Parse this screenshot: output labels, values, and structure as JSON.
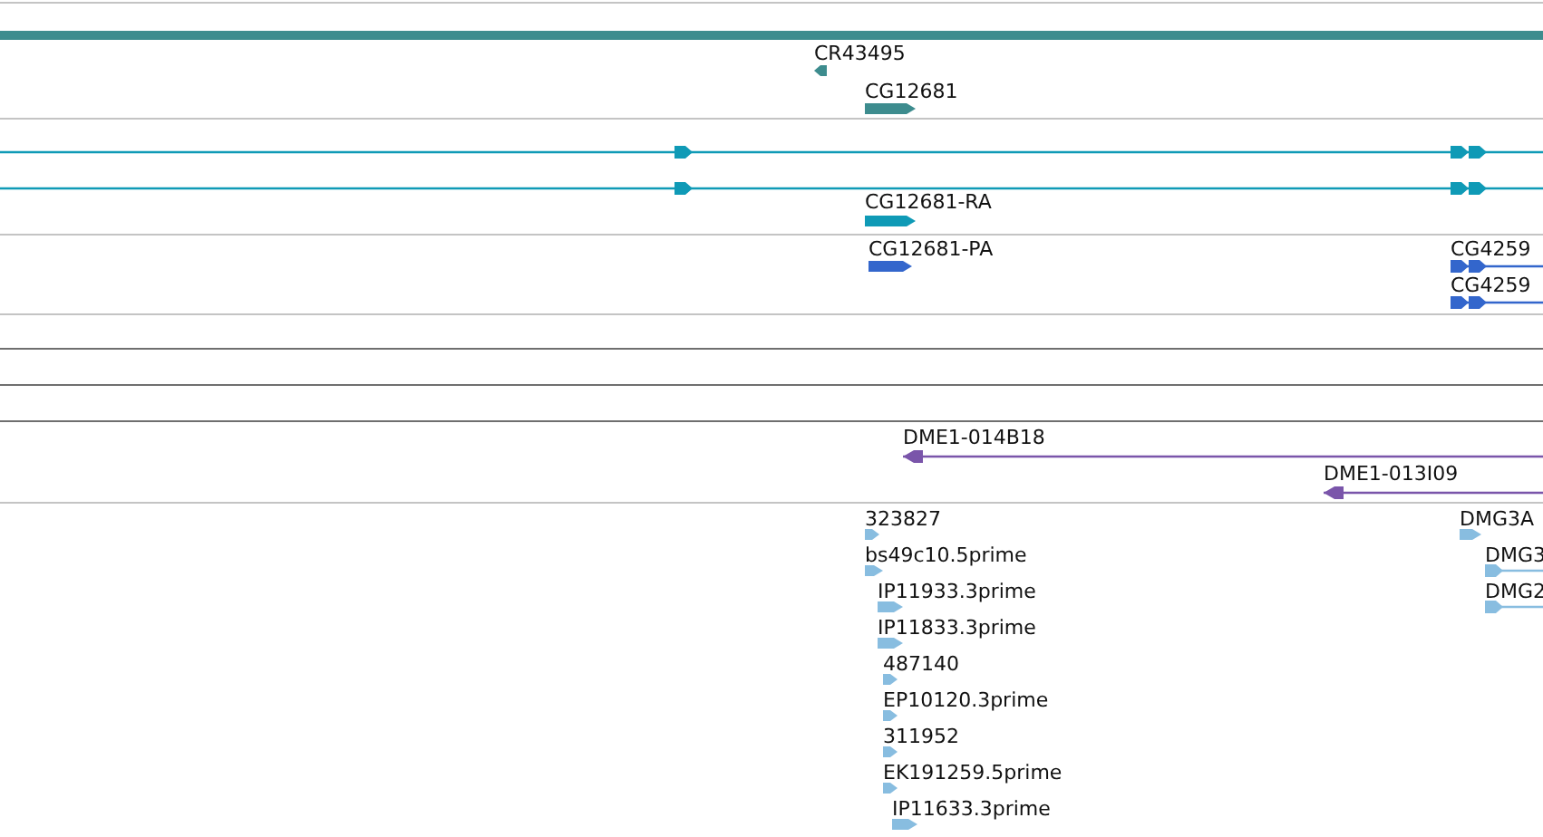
{
  "tracks": [
    {
      "kind": "features",
      "color": "#3d8c8e",
      "features": [
        {
          "kind": "bar"
        },
        {
          "kind": "block",
          "label": "CR43495",
          "reverse": true
        },
        {
          "kind": "block",
          "label": "CG12681",
          "reverse": false
        }
      ]
    },
    {
      "kind": "features",
      "color": "#0f9ab6",
      "features": [
        {
          "kind": "line",
          "reverse": false
        },
        {
          "kind": "line",
          "reverse": false
        },
        {
          "kind": "block",
          "label": "CG12681-RA",
          "reverse": false
        }
      ]
    },
    {
      "kind": "features",
      "color": "#3366cc",
      "features": [
        {
          "kind": "block",
          "label": "CG12681-PA",
          "reverse": false
        },
        {
          "kind": "line",
          "label": "CG4259",
          "reverse": false
        },
        {
          "kind": "line",
          "label": "CG4259",
          "reverse": false
        }
      ]
    },
    {
      "kind": "empty"
    },
    {
      "kind": "empty"
    },
    {
      "kind": "empty"
    },
    {
      "kind": "features",
      "color": "#7a55aa",
      "features": [
        {
          "kind": "line",
          "label": "DME1-014B18",
          "reverse": true
        },
        {
          "kind": "line",
          "label": "DME1-013I09",
          "reverse": true
        }
      ]
    },
    {
      "kind": "features",
      "color": "#88bde0",
      "features": [
        {
          "kind": "block",
          "label": "323827",
          "reverse": false
        },
        {
          "kind": "block",
          "label": "bs49c10.5prime",
          "reverse": false
        },
        {
          "kind": "block",
          "label": "IP11933.3prime",
          "reverse": false
        },
        {
          "kind": "block",
          "label": "IP11833.3prime",
          "reverse": false
        },
        {
          "kind": "block",
          "label": "487140",
          "reverse": false
        },
        {
          "kind": "block",
          "label": "EP10120.3prime",
          "reverse": false
        },
        {
          "kind": "block",
          "label": "311952",
          "reverse": false
        },
        {
          "kind": "block",
          "label": "EK191259.5prime",
          "reverse": false
        },
        {
          "kind": "block",
          "label": "IP11633.3prime",
          "reverse": false
        },
        {
          "kind": "block",
          "label": "DMG3A",
          "reverse": false
        },
        {
          "kind": "line",
          "label": "DMG3",
          "reverse": false
        },
        {
          "kind": "line",
          "label": "DMG2",
          "reverse": false
        }
      ]
    }
  ]
}
